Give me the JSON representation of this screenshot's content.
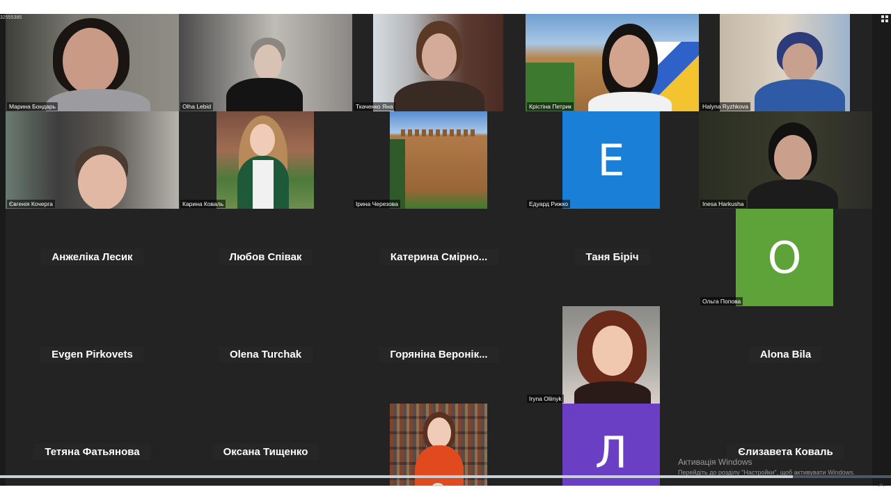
{
  "meeting": {
    "id_fragment": "32555385"
  },
  "tiles": [
    {
      "name": "Марина Бондарь"
    },
    {
      "name": "Olha Lebid"
    },
    {
      "name": "Ткаченко Яна"
    },
    {
      "name": "Крістіна Петрик"
    },
    {
      "name": "Halyna Ryzhkova"
    },
    {
      "name": "Євгенія Кочерга"
    },
    {
      "name": "Карина Коваль"
    },
    {
      "name": "Ірина Черезова"
    },
    {
      "name": "Едуард Рижко",
      "initial": "E",
      "color": "#1a7fd6"
    },
    {
      "name": "Inesa Harkusha"
    },
    {
      "name": "Анжеліка Лесик"
    },
    {
      "name": "Любов Співак"
    },
    {
      "name": "Катерина  Смірно..."
    },
    {
      "name": "Таня Біріч"
    },
    {
      "name": "Ольга Попова",
      "initial": "O",
      "color": "#5ea33a"
    },
    {
      "name": "Evgen Pirkovets"
    },
    {
      "name": "Olena Turchak"
    },
    {
      "name": "Горяніна  Веронік..."
    },
    {
      "name": "Iryna  Oliinyk"
    },
    {
      "name": "Alona Bila"
    },
    {
      "name": "Тетяна Фатьянова"
    },
    {
      "name": "Оксана Тищенко"
    },
    {
      "name": "Л",
      "initial": "Л",
      "color": "#6a3fc4"
    },
    {
      "name": "Єлизавета Коваль"
    }
  ],
  "windows_activation": {
    "title": "Активація Windows",
    "subtitle": "Перейдіть до розділу \"Настройки\", щоб активувати Windows."
  },
  "playback": {
    "progress_fraction": 0.89
  },
  "icons": [
    "grid-view-icon",
    "progress-knob-icon"
  ]
}
